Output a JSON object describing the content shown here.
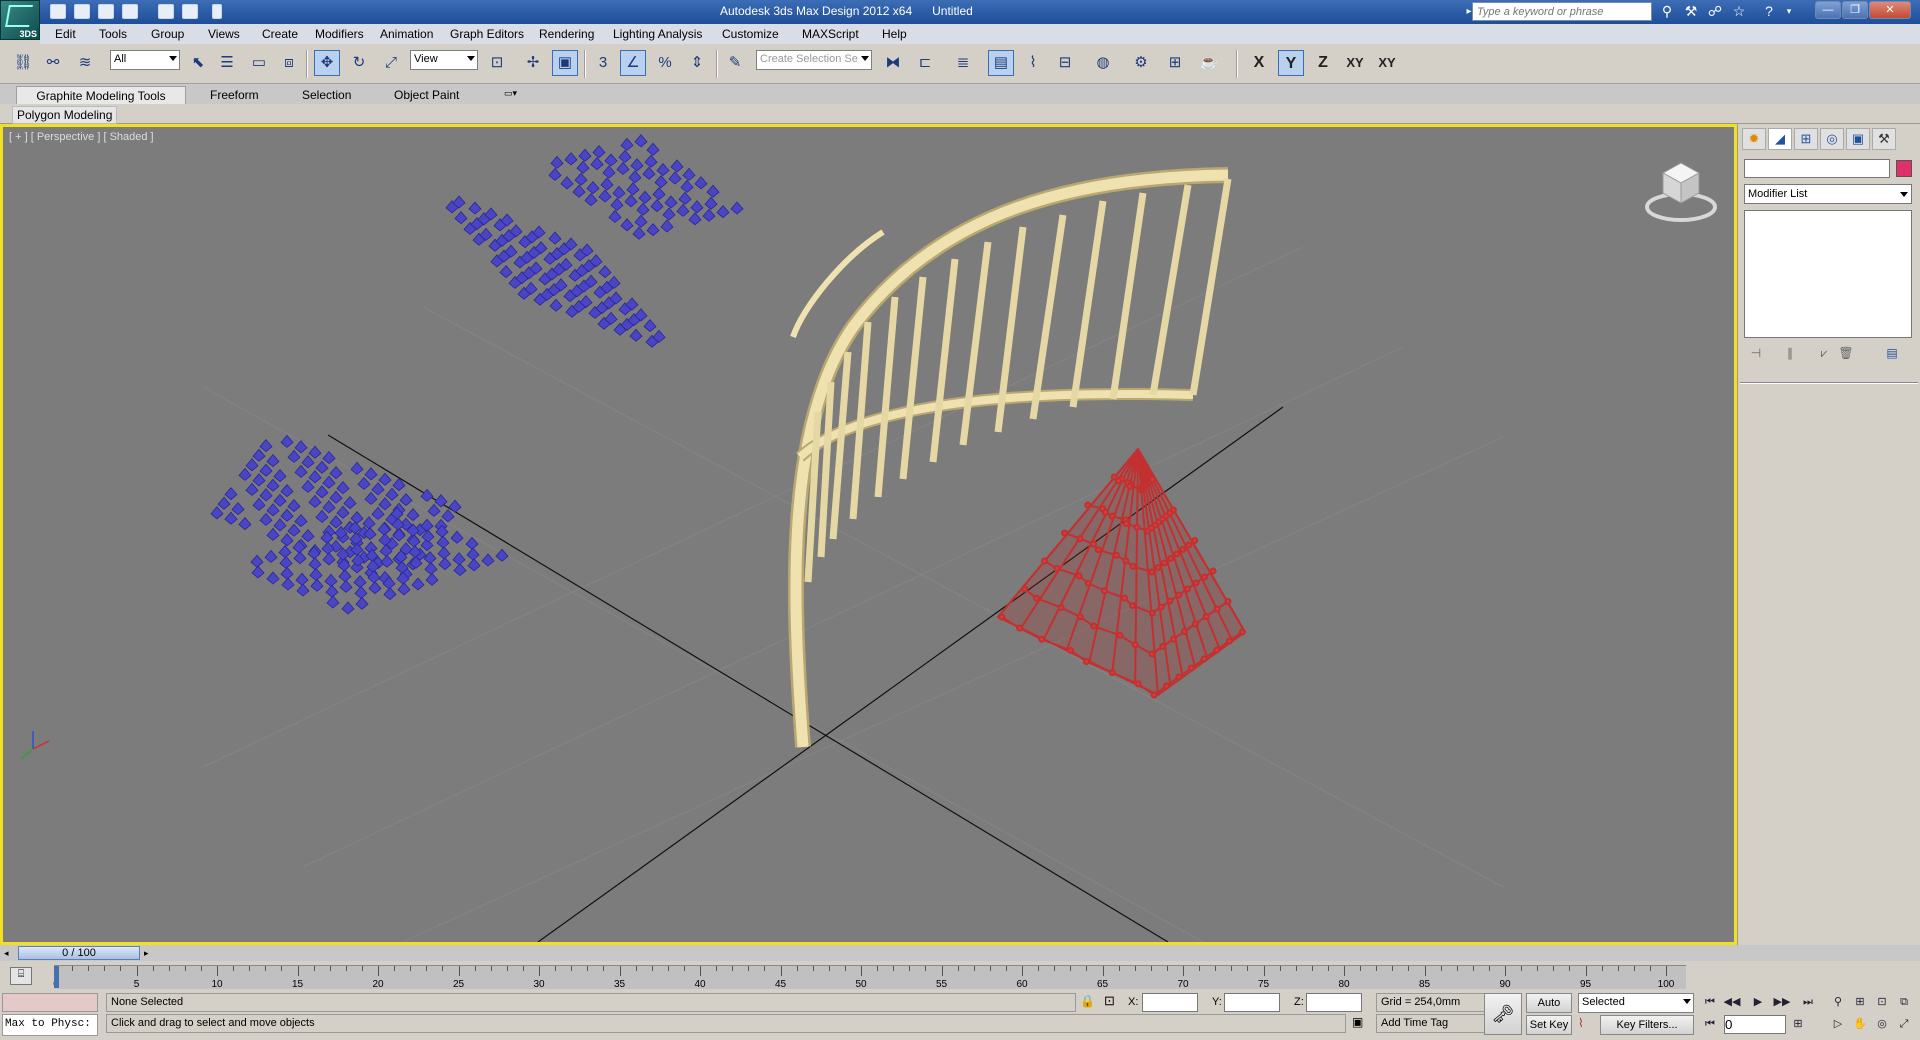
{
  "window": {
    "title": "Autodesk 3ds Max Design 2012 x64      Untitled",
    "app_badge": "3DS",
    "search_placeholder": "Type a keyword or phrase"
  },
  "menu": [
    "Edit",
    "Tools",
    "Group",
    "Views",
    "Create",
    "Modifiers",
    "Animation",
    "Graph Editors",
    "Rendering",
    "Lighting Analysis",
    "Customize",
    "MAXScript",
    "Help"
  ],
  "toolbar": {
    "selection_filter": "All",
    "reference_coord": "View",
    "named_selection_placeholder": "Create Selection Se",
    "axis": [
      "X",
      "Y",
      "Z",
      "XY",
      "XY"
    ],
    "snap_label": "3",
    "percent_label": "%"
  },
  "ribbon": {
    "tabs": [
      "Graphite Modeling Tools",
      "Freeform",
      "Selection",
      "Object Paint"
    ],
    "panel": "Polygon Modeling"
  },
  "viewport": {
    "label": "[ + ] [ Perspective ] [ Shaded ]",
    "border_color": "#f0e020",
    "background": "#7c7c7c",
    "objects": [
      "blue-pyramid-array",
      "curved-railing-frame",
      "red-lattice-shell"
    ]
  },
  "command_panel": {
    "modifier_list": "Modifier List",
    "object_color": "#e0306a"
  },
  "timeline": {
    "slider": "0 / 100",
    "ticks": [
      "0",
      "5",
      "10",
      "15",
      "20",
      "25",
      "30",
      "35",
      "40",
      "45",
      "50",
      "55",
      "60",
      "65",
      "70",
      "75",
      "80",
      "85",
      "90",
      "95",
      "100"
    ]
  },
  "status": {
    "maxscript": "Max to Physc:",
    "selection": "None Selected",
    "prompt": "Click and drag to select and move objects",
    "x_label": "X:",
    "y_label": "Y:",
    "z_label": "Z:",
    "grid": "Grid = 254,0mm",
    "add_time_tag": "Add Time Tag",
    "auto_key": "Auto Key",
    "set_key": "Set Key",
    "key_mode": "Selected",
    "key_filters": "Key Filters...",
    "frame": "0"
  }
}
